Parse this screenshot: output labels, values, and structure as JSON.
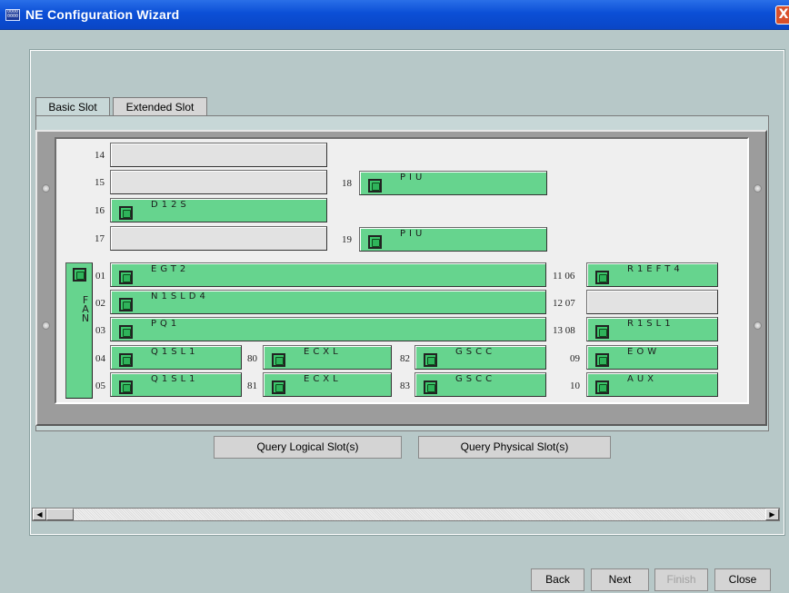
{
  "window": {
    "title": "NE Configuration Wizard",
    "icon_text": "0000 0000",
    "close_glyph": "X"
  },
  "tabs": [
    {
      "label": "Basic Slot",
      "active": true
    },
    {
      "label": "Extended Slot",
      "active": false
    }
  ],
  "fan": {
    "text": "FAN"
  },
  "slots": {
    "s14": {
      "num": "14",
      "label": ""
    },
    "s15": {
      "num": "15",
      "label": ""
    },
    "s16": {
      "num": "16",
      "label": "D12S"
    },
    "s17": {
      "num": "17",
      "label": ""
    },
    "s18": {
      "num": "18",
      "label": "PIU"
    },
    "s19": {
      "num": "19",
      "label": "PIU"
    },
    "s01": {
      "num": "01",
      "label": "EGT2"
    },
    "s02": {
      "num": "02",
      "label": "N1SLD4"
    },
    "s03": {
      "num": "03",
      "label": "PQ1"
    },
    "s04": {
      "num": "04",
      "label": "Q1SL1"
    },
    "s05": {
      "num": "05",
      "label": "Q1SL1"
    },
    "s80": {
      "num": "80",
      "label": "ECXL"
    },
    "s81": {
      "num": "81",
      "label": "ECXL"
    },
    "s82": {
      "num": "82",
      "label": "GSCC"
    },
    "s83": {
      "num": "83",
      "label": "GSCC"
    },
    "s06": {
      "num": "11 06",
      "label": "R1EFT4"
    },
    "s07": {
      "num": "12 07",
      "label": ""
    },
    "s08": {
      "num": "13 08",
      "label": "R1SL1"
    },
    "s09": {
      "num": "09",
      "label": "EOW"
    },
    "s10": {
      "num": "10",
      "label": "AUX"
    }
  },
  "query_buttons": {
    "logical": "Query Logical Slot(s)",
    "physical": "Query Physical Slot(s)"
  },
  "footer_buttons": {
    "back": "Back",
    "next": "Next",
    "finish": "Finish",
    "close": "Close"
  },
  "scrollbar": {
    "left_arrow": "◀",
    "right_arrow": "▶"
  }
}
